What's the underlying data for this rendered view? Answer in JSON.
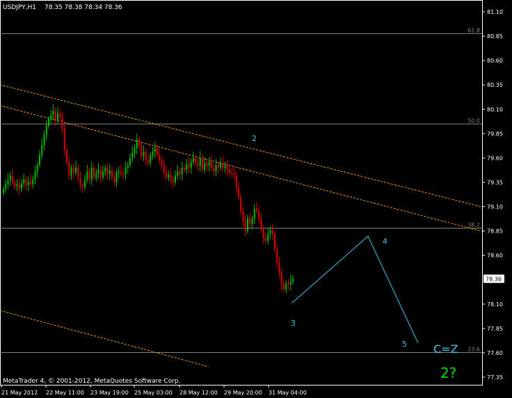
{
  "header": {
    "symbol_tf": "USDJPY,H1",
    "ohlc": "78.35 78.38 78.34 78.36"
  },
  "footer": {
    "copyright": "MetaTrader 4, © 2001-2012, MetaQuotes Software Corp."
  },
  "colors": {
    "background": "#000000",
    "axis": "#ffffff",
    "bull_candle": "#00c000",
    "bear_candle": "#e00000",
    "fib_line": "#808080",
    "channel_line": "#ff9900",
    "projection_line": "#40c8e8",
    "green_text": "#00e000"
  },
  "price_axis": {
    "ticks": [
      "81.10",
      "80.85",
      "80.60",
      "80.35",
      "80.10",
      "79.85",
      "79.60",
      "79.35",
      "79.10",
      "78.85",
      "78.60",
      "78.36",
      "78.10",
      "77.85",
      "77.60",
      "77.35"
    ],
    "current_price": "78.36"
  },
  "time_axis": {
    "ticks": [
      "21 May 2012",
      "22 May 11:00",
      "23 May 19:00",
      "25 May 03:00",
      "28 May 12:00",
      "29 May 20:00",
      "31 May 04:00"
    ]
  },
  "fib_levels": [
    {
      "label": "61.8",
      "price": 80.88
    },
    {
      "label": "50.0",
      "price": 79.95
    },
    {
      "label": "38.2",
      "price": 78.88
    },
    {
      "label": "23.6",
      "price": 77.61
    }
  ],
  "wave_labels": {
    "w2": "2",
    "w3": "3",
    "w4": "4",
    "w5": "5",
    "cz": "C=Z",
    "question": "2?"
  },
  "chart_data": {
    "type": "candlestick",
    "symbol": "USDJPY",
    "timeframe": "H1",
    "close_series": [
      79.28,
      79.33,
      79.37,
      79.42,
      79.35,
      79.31,
      79.33,
      79.28,
      79.34,
      79.38,
      79.32,
      79.36,
      79.33,
      79.38,
      79.46,
      79.53,
      79.63,
      79.73,
      79.84,
      79.93,
      80.0,
      80.04,
      80.08,
      79.98,
      80.06,
      80.02,
      79.9,
      79.68,
      79.56,
      79.42,
      79.5,
      79.45,
      79.5,
      79.4,
      79.32,
      79.3,
      79.38,
      79.46,
      79.38,
      79.5,
      79.4,
      79.44,
      79.48,
      79.4,
      79.46,
      79.5,
      79.43,
      79.47,
      79.4,
      79.35,
      79.45,
      79.46,
      79.44,
      79.43,
      79.5,
      79.53,
      79.6,
      79.65,
      79.7,
      79.79,
      79.73,
      79.62,
      79.66,
      79.58,
      79.55,
      79.63,
      79.66,
      79.7,
      79.63,
      79.58,
      79.53,
      79.45,
      79.4,
      79.43,
      79.38,
      79.35,
      79.42,
      79.46,
      79.43,
      79.5,
      79.48,
      79.54,
      79.5,
      79.56,
      79.6,
      79.55,
      79.52,
      79.6,
      79.48,
      79.55,
      79.52,
      79.56,
      79.5,
      79.46,
      79.53,
      79.5,
      79.55,
      79.5,
      79.52,
      79.48,
      79.45,
      79.44,
      79.42,
      79.3,
      79.2,
      79.05,
      78.95,
      78.85,
      78.98,
      78.92,
      78.98,
      79.08,
      79.06,
      78.97,
      78.88,
      78.78,
      78.75,
      78.82,
      78.86,
      78.82,
      78.66,
      78.52,
      78.43,
      78.3,
      78.25,
      78.31,
      78.3,
      78.33,
      78.36
    ]
  }
}
